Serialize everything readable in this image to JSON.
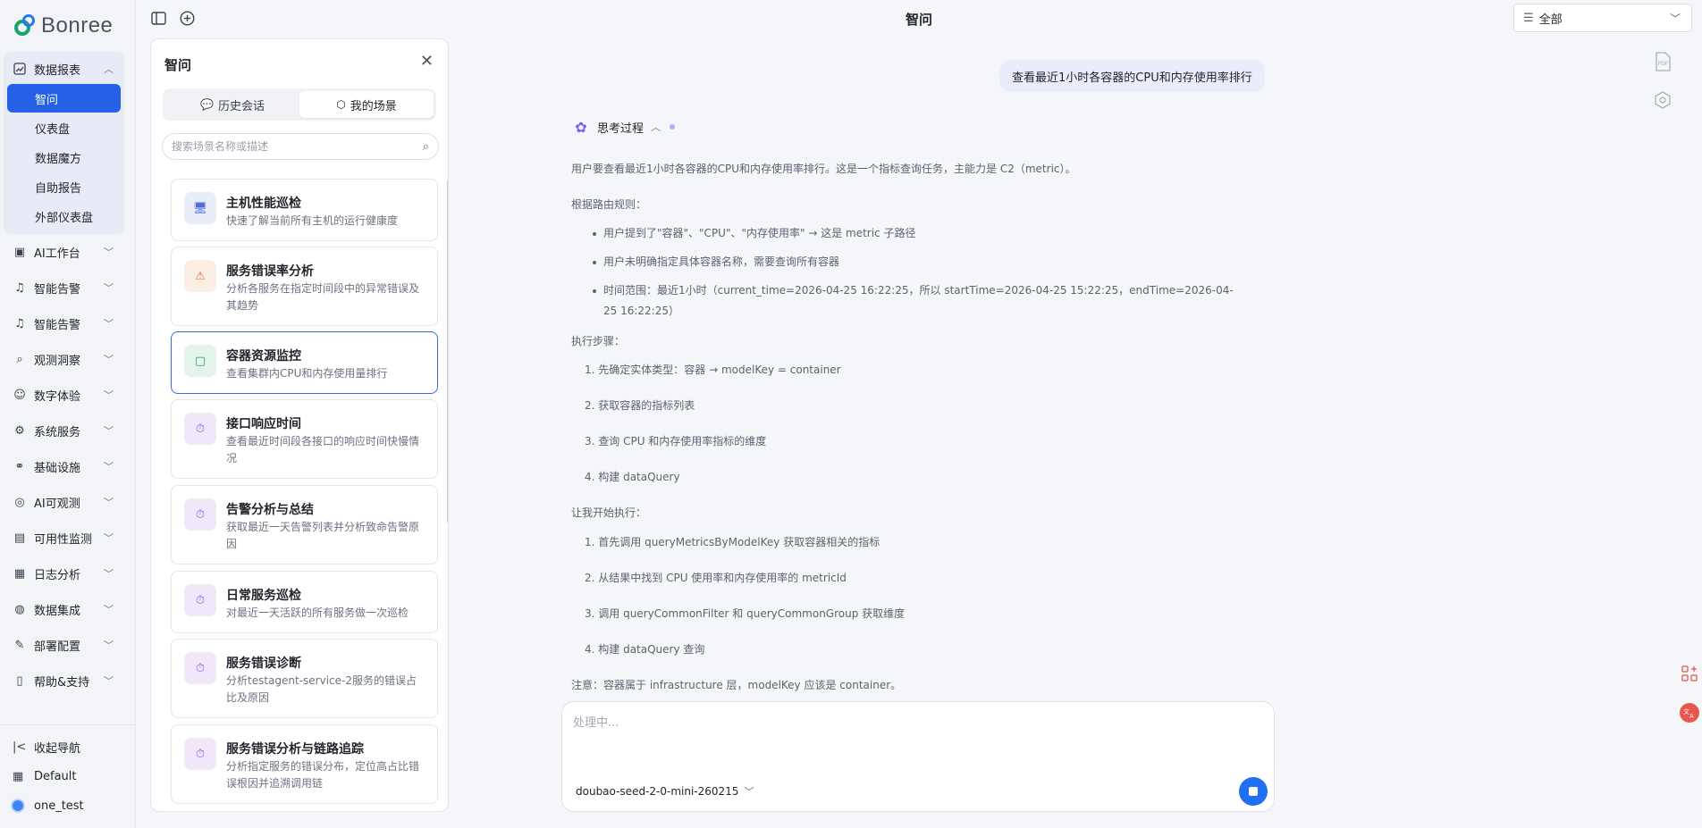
{
  "brand": {
    "name": "Bonree"
  },
  "sidebar": {
    "open_group": {
      "label": "数据报表",
      "icon": "chart-icon"
    },
    "sub_items": [
      {
        "label": "智问",
        "active": true
      },
      {
        "label": "仪表盘"
      },
      {
        "label": "数据魔方"
      },
      {
        "label": "自助报告"
      },
      {
        "label": "外部仪表盘"
      }
    ],
    "groups": [
      {
        "label": "AI工作台",
        "icon": "ai-workbench-icon"
      },
      {
        "label": "智能告警",
        "icon": "alert-icon"
      },
      {
        "label": "智能告警",
        "icon": "alert-icon"
      },
      {
        "label": "观测洞察",
        "icon": "insight-icon"
      },
      {
        "label": "数字体验",
        "icon": "user-experience-icon"
      },
      {
        "label": "系统服务",
        "icon": "service-icon"
      },
      {
        "label": "基础设施",
        "icon": "infrastructure-icon"
      },
      {
        "label": "AI可观测",
        "icon": "ai-observe-icon"
      },
      {
        "label": "可用性监测",
        "icon": "availability-icon"
      },
      {
        "label": "日志分析",
        "icon": "log-icon"
      },
      {
        "label": "数据集成",
        "icon": "integration-icon"
      },
      {
        "label": "部署配置",
        "icon": "deploy-icon"
      },
      {
        "label": "帮助&支持",
        "icon": "help-icon"
      }
    ],
    "footer": {
      "collapse_label": "收起导航",
      "workspace_label": "Default",
      "user_label": "one_test"
    }
  },
  "topbar": {
    "title": "智问",
    "scope_value": "全部"
  },
  "panel": {
    "title": "智问",
    "tabs": [
      {
        "label": "历史会话"
      },
      {
        "label": "我的场景",
        "active": true
      }
    ],
    "search_placeholder": "搜索场景名称或描述",
    "cards": [
      {
        "title": "主机性能巡检",
        "desc": "快速了解当前所有主机的运行健康度",
        "icon": "monitor-icon",
        "bg": "#e9edf9",
        "fg": "#4f6bd8"
      },
      {
        "title": "服务错误率分析",
        "desc": "分析各服务在指定时间段中的异常错误及其趋势",
        "icon": "warning-icon",
        "bg": "#fdeee3",
        "fg": "#e0782f"
      },
      {
        "title": "容器资源监控",
        "desc": "查看集群内CPU和内存使用量排行",
        "icon": "container-icon",
        "bg": "#e3f5ea",
        "fg": "#2a9a5c",
        "selected": true
      },
      {
        "title": "接口响应时间",
        "desc": "查看最近时间段各接口的响应时间快慢情况",
        "icon": "timer-icon",
        "bg": "#f0e8fa",
        "fg": "#8c59d8"
      },
      {
        "title": "告警分析与总结",
        "desc": "获取最近一天告警列表并分析致命告警原因",
        "icon": "timer-icon",
        "bg": "#f0e8fa",
        "fg": "#8c59d8"
      },
      {
        "title": "日常服务巡检",
        "desc": "对最近一天活跃的所有服务做一次巡检",
        "icon": "timer-icon",
        "bg": "#f0e8fa",
        "fg": "#8c59d8"
      },
      {
        "title": "服务错误诊断",
        "desc": "分析testagent-service-2服务的错误占比及原因",
        "icon": "timer-icon",
        "bg": "#f0e8fa",
        "fg": "#8c59d8"
      },
      {
        "title": "服务错误分析与链路追踪",
        "desc": "分析指定服务的错误分布，定位高占比错误根因并追溯调用链",
        "icon": "timer-icon",
        "bg": "#f0e8fa",
        "fg": "#8c59d8"
      }
    ]
  },
  "chat": {
    "user_message": "查看最近1小时各容器的CPU和内存使用率排行",
    "thinking_label": "思考过程",
    "thinking": {
      "intro": "用户要查看最近1小时各容器的CPU和内存使用率排行。这是一个指标查询任务，主能力是 C2（metric）。",
      "rules_heading": "根据路由规则：",
      "rules": [
        "用户提到了\"容器\"、\"CPU\"、\"内存使用率\" → 这是 metric 子路径",
        "用户未明确指定具体容器名称，需要查询所有容器",
        "时间范围：最近1小时（current_time=2026-04-25 16:22:25，所以 startTime=2026-04-25 15:22:25，endTime=2026-04-",
        "25 16:22:25）"
      ],
      "steps_heading": "执行步骤：",
      "steps": [
        "1.  先确定实体类型：容器 → modelKey = container",
        "2.  获取容器的指标列表",
        "3.  查询 CPU 和内存使用率指标的维度",
        "4.  构建 dataQuery"
      ],
      "exec_heading": "让我开始执行：",
      "exec_steps": [
        "1.  首先调用 queryMetricsByModelKey 获取容器相关的指标",
        "2.  从结果中找到 CPU 使用率和内存使用率的 metricId",
        "3.  调用 queryCommonFilter 和 queryCommonGroup 获取维度",
        "4.  构建 dataQuery 查询"
      ],
      "note": "注意：容器属于 infrastructure 层，modelKey 应该是 container。"
    },
    "composer_placeholder": "处理中...",
    "model_name": "doubao-seed-2-0-mini-260215",
    "right_icons": [
      "pdf-export-icon",
      "model-cube-icon"
    ],
    "floating_icons": [
      "apps-icon",
      "translate-icon"
    ]
  }
}
